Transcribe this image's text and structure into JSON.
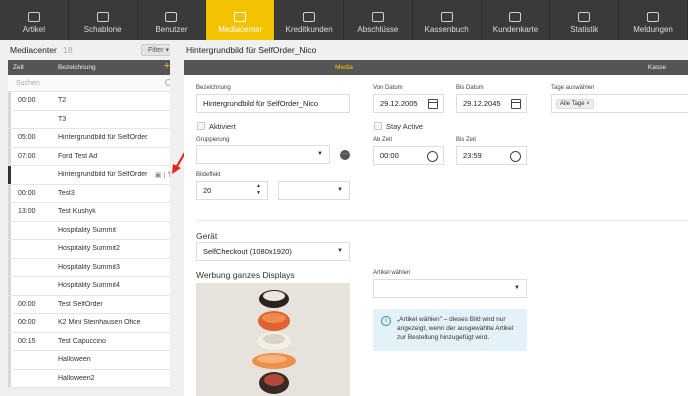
{
  "nav": {
    "items": [
      {
        "label": "Artikel",
        "icon": "register-icon"
      },
      {
        "label": "Schablone",
        "icon": "template-icon"
      },
      {
        "label": "Benutzer",
        "icon": "users-icon"
      },
      {
        "label": "Mediacenter",
        "icon": "monitor-icon"
      },
      {
        "label": "Kreditkunden",
        "icon": "credit-card-icon"
      },
      {
        "label": "Abschlüsse",
        "icon": "document-icon"
      },
      {
        "label": "Kassenbuch",
        "icon": "book-icon"
      },
      {
        "label": "Kundenkarte",
        "icon": "card-icon"
      },
      {
        "label": "Statistik",
        "icon": "chart-icon"
      },
      {
        "label": "Meldungen",
        "icon": "mail-icon"
      }
    ],
    "active_index": 3,
    "accent": "#f3c200"
  },
  "sidebar": {
    "title": "Mediacenter",
    "count": "18",
    "filter_label": "Filter",
    "col_zeit": "Zeit",
    "col_bezeichnung": "Bezeichnung",
    "add_symbol": "+",
    "search_placeholder": "Suchen",
    "rows": [
      {
        "zeit": "00:00",
        "bez": "T2"
      },
      {
        "zeit": "",
        "bez": "T3"
      },
      {
        "zeit": "05:00",
        "bez": "Hintergrundbild für SelfOrder"
      },
      {
        "zeit": "07:00",
        "bez": "Ford Test Ad"
      },
      {
        "zeit": "",
        "bez": "Hintergrundbild für SelfOrder"
      },
      {
        "zeit": "00:00",
        "bez": "Test3"
      },
      {
        "zeit": "13:00",
        "bez": "Test Kushyk"
      },
      {
        "zeit": "",
        "bez": "Hospitality Summit"
      },
      {
        "zeit": "",
        "bez": "Hospitality Summit2"
      },
      {
        "zeit": "",
        "bez": "Hospitality Summit3"
      },
      {
        "zeit": "",
        "bez": "Hospitality Summit4"
      },
      {
        "zeit": "00:00",
        "bez": "Test SelfOrder"
      },
      {
        "zeit": "00:00",
        "bez": "K2 Mini Steinhausen Ofice"
      },
      {
        "zeit": "00:15",
        "bez": "Test Capuccino"
      },
      {
        "zeit": "",
        "bez": "Halloween"
      },
      {
        "zeit": "",
        "bez": "Halloween2"
      }
    ],
    "selected_index": 4
  },
  "main": {
    "title": "Hintergrundbild für SelfOrder_Nico",
    "tab_media": "Media",
    "tab_kasse": "Kasse",
    "bezeichnung_label": "Bezeichnung",
    "bezeichnung_value": "Hintergrundbild für SelfOrder_Nico",
    "aktiviert_label": "Aktiviert",
    "gruppierung_label": "Gruppierung",
    "gruppierung_value": "",
    "bildeffekt_label": "Bildeffekt",
    "bildeffekt_value": "20",
    "von_datum_label": "Von Datum",
    "von_datum_value": "29.12.2005",
    "bis_datum_label": "Bis Datum",
    "bis_datum_value": "29.12.2045",
    "stay_active_label": "Stay Active",
    "ab_zeit_label": "Ab Zeit",
    "ab_zeit_value": "00:00",
    "bis_zeit_label": "Bis Zeit",
    "bis_zeit_value": "23:59",
    "tage_label": "Tage auswählen",
    "tage_tag": "Alle Tage",
    "geraet_label": "Gerät",
    "geraet_value": "SelfCheckout (1080x1920)",
    "werbung_label": "Werbung ganzes Displays",
    "artikel_label": "Artikel wählen",
    "artikel_value": "",
    "info_text": "„Artikel wählen\" – dieses Bild wird nur angezeigt, wenn der ausgewählte Artikel zur Bestellung hinzugefügt wird."
  }
}
